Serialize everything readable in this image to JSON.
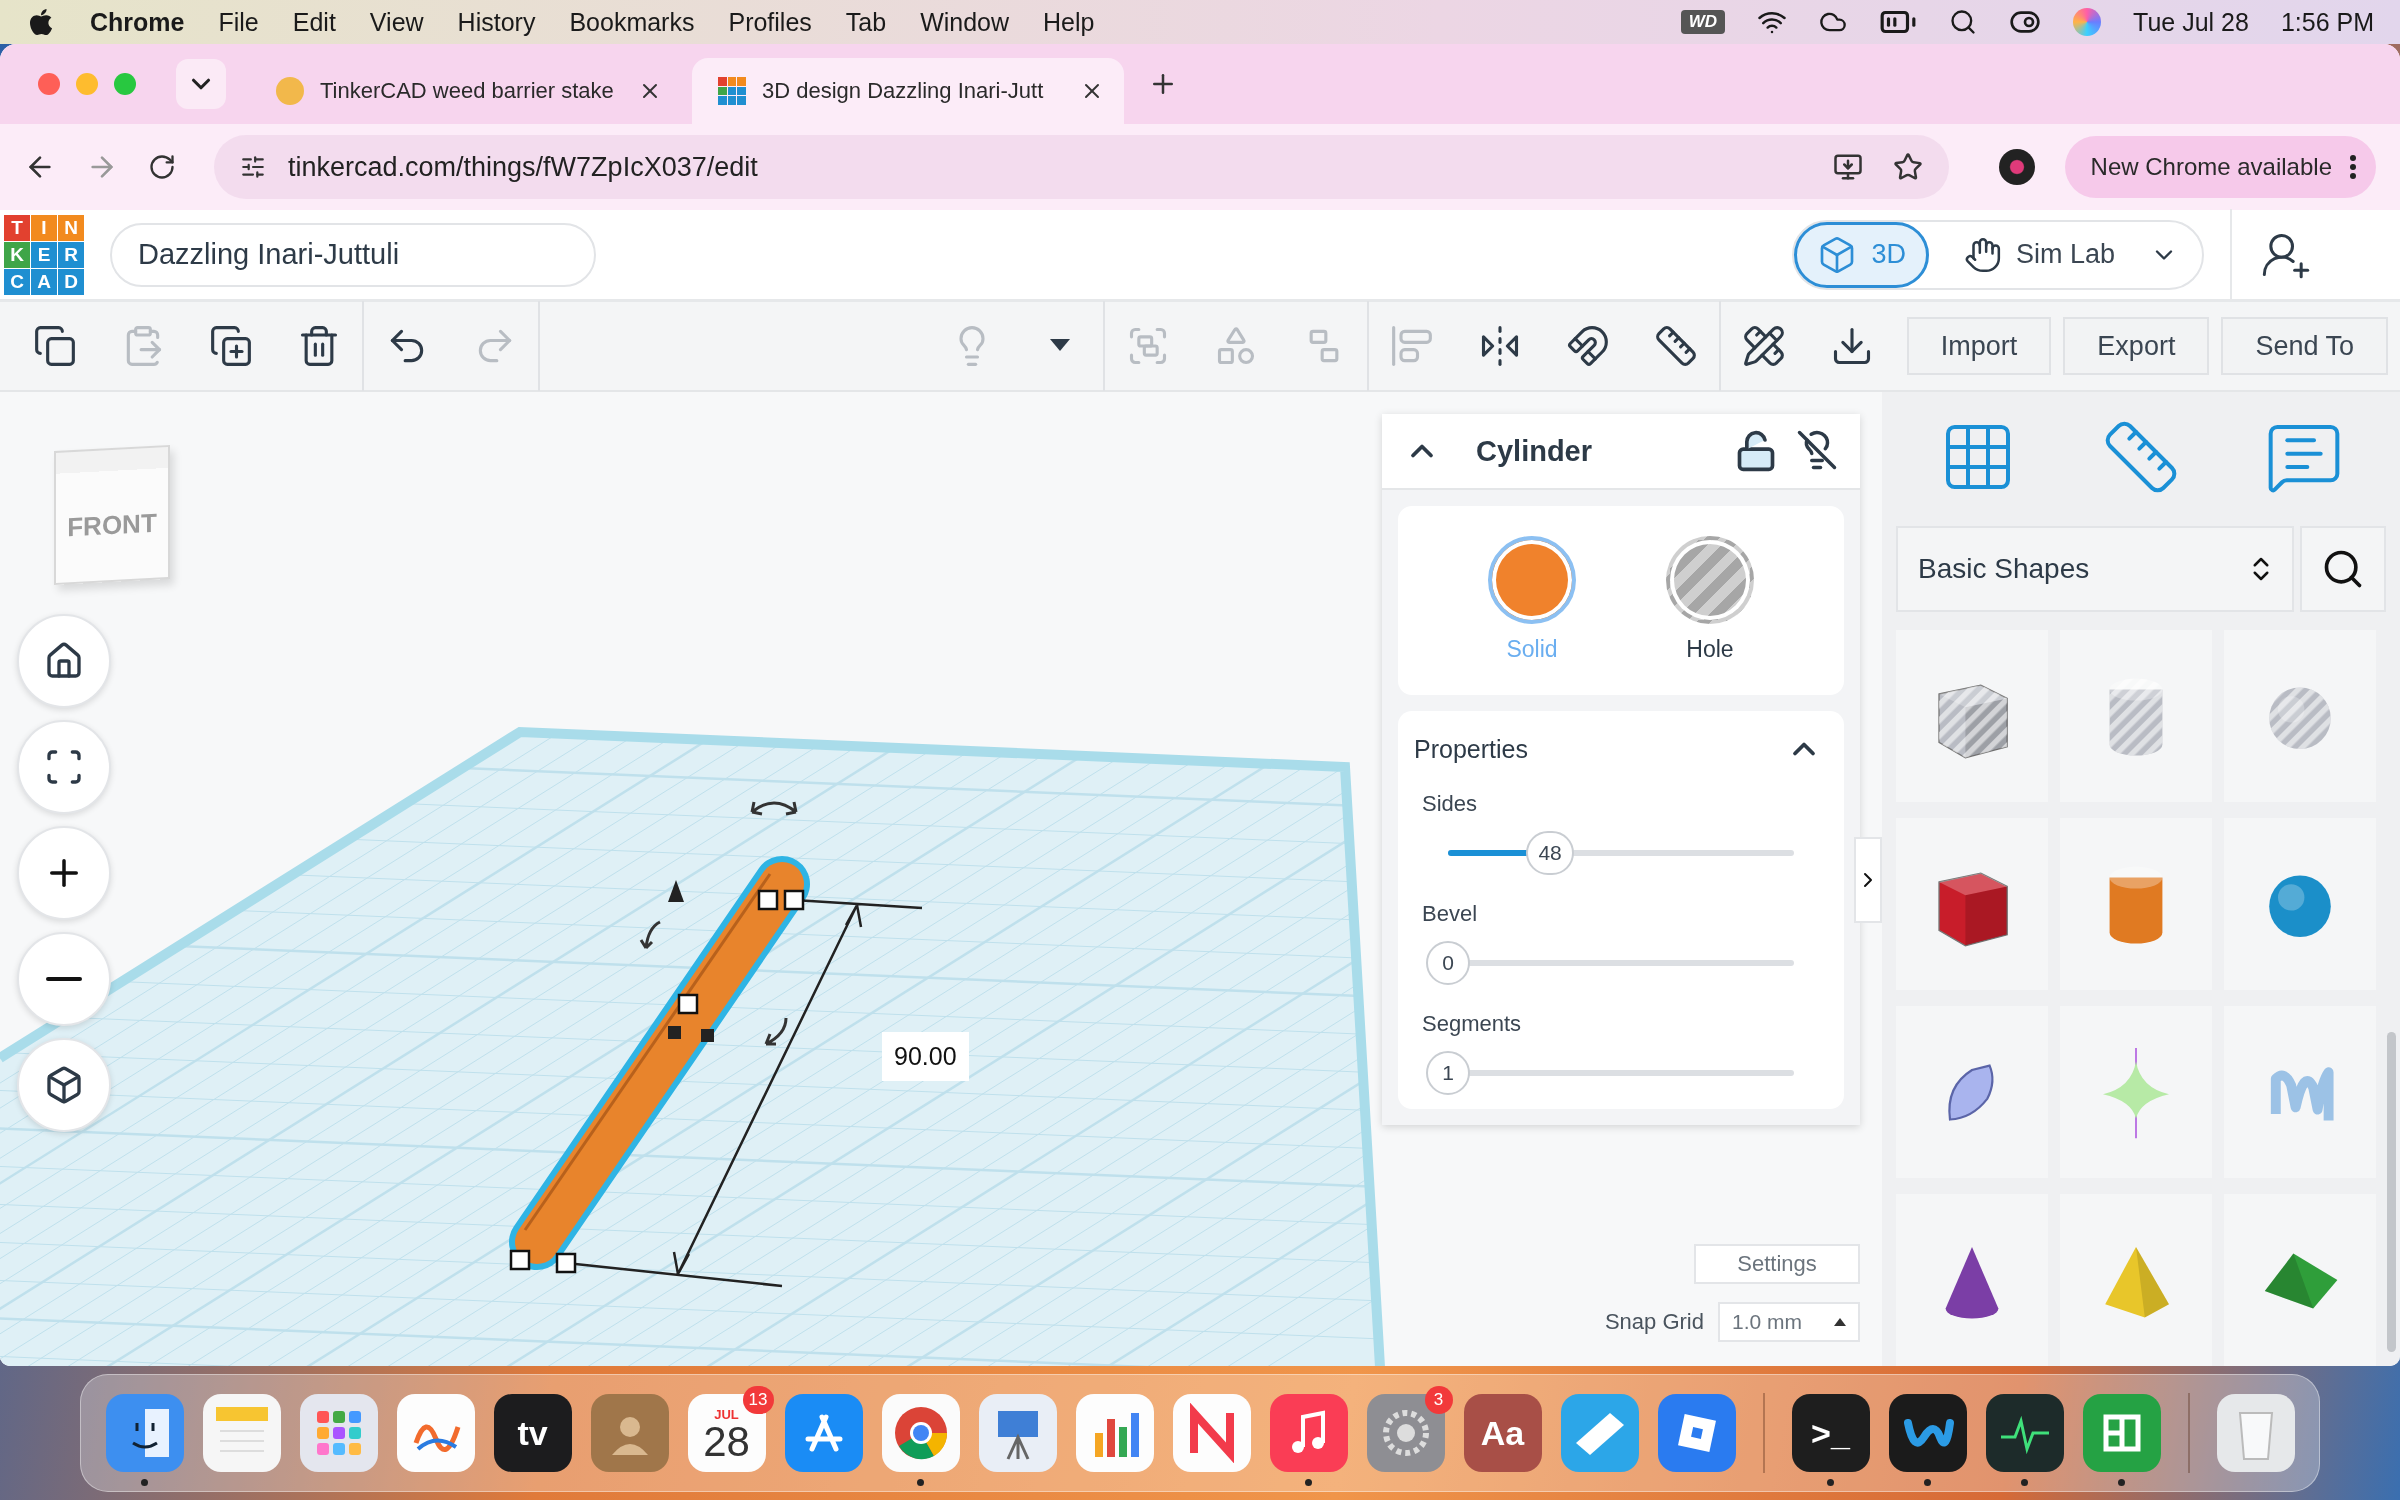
{
  "menu_bar": {
    "app_name": "Chrome",
    "items": [
      "File",
      "Edit",
      "View",
      "History",
      "Bookmarks",
      "Profiles",
      "Tab",
      "Window",
      "Help"
    ],
    "drive_badge": "WD",
    "date": "Tue Jul 28",
    "time": "1:56 PM"
  },
  "browser": {
    "tabs": [
      {
        "title": "TinkerCAD weed barrier stake",
        "selected": false,
        "kind": "figure"
      },
      {
        "title": "3D design Dazzling Inari-Jutt",
        "selected": true,
        "kind": "logo"
      }
    ],
    "url": "tinkercad.com/things/fW7ZpIcX037/edit",
    "update_label": "New Chrome available"
  },
  "app": {
    "logo_letters": [
      "T",
      "I",
      "N",
      "K",
      "E",
      "R",
      "C",
      "A",
      "D"
    ],
    "design_name": "Dazzling Inari-Juttuli",
    "modes": [
      {
        "label": "3D",
        "kind": "cube",
        "selected": true
      },
      {
        "label": "Sim Lab",
        "kind": "hand",
        "selected": false
      }
    ],
    "toolbar": {
      "left_groups": [
        [
          {
            "kind": "copy",
            "disabled": false
          },
          {
            "kind": "paste",
            "disabled": true
          },
          {
            "kind": "duplicate",
            "disabled": false
          },
          {
            "kind": "delete",
            "disabled": false
          }
        ],
        [
          {
            "kind": "undo",
            "disabled": false
          },
          {
            "kind": "redo",
            "disabled": true
          }
        ]
      ],
      "right_groups": [
        [
          {
            "kind": "light",
            "disabled": true
          },
          {
            "kind": "light-menu",
            "disabled": false
          }
        ],
        [
          {
            "kind": "group",
            "disabled": true
          },
          {
            "kind": "combine",
            "disabled": true
          },
          {
            "kind": "ungroup",
            "disabled": true
          }
        ],
        [
          {
            "kind": "align",
            "disabled": true
          },
          {
            "kind": "mirror",
            "disabled": false
          },
          {
            "kind": "magnet",
            "disabled": false
          },
          {
            "kind": "ruler",
            "disabled": false
          }
        ],
        [
          {
            "kind": "workplane",
            "disabled": false
          },
          {
            "kind": "drop",
            "disabled": false
          }
        ]
      ],
      "actions": [
        "Import",
        "Export",
        "Send To"
      ]
    }
  },
  "viewport": {
    "view_cube": "FRONT",
    "dimension": "90.00",
    "settings": "Settings",
    "snap_label": "Snap Grid",
    "snap_value": "1.0 mm"
  },
  "inspector": {
    "title": "Cylinder",
    "locked": false,
    "materials": [
      {
        "label": "Solid",
        "kind": "solid",
        "selected": true
      },
      {
        "label": "Hole",
        "kind": "hole",
        "selected": false
      }
    ],
    "properties_title": "Properties",
    "sliders": [
      {
        "label": "Sides",
        "value": "48",
        "level": 0.31
      },
      {
        "label": "Bevel",
        "value": "0",
        "level": 0
      },
      {
        "label": "Segments",
        "value": "1",
        "level": 0
      }
    ]
  },
  "library": {
    "category": "Basic Shapes",
    "shapes": [
      {
        "kind": "box",
        "color": "#b9bcc4",
        "hole": true
      },
      {
        "kind": "cylinder",
        "color": "#b9bcc4",
        "hole": true
      },
      {
        "kind": "sphere",
        "color": "#b9bcc4",
        "hole": true
      },
      {
        "kind": "box",
        "color": "#c81d2a",
        "hole": false
      },
      {
        "kind": "cylinder",
        "color": "#e07a22",
        "hole": false
      },
      {
        "kind": "sphere",
        "color": "#1b8fc9",
        "hole": false
      },
      {
        "kind": "pen",
        "color": "#a9b4ee"
      },
      {
        "kind": "spinner",
        "color": "#b7eaa6"
      },
      {
        "kind": "scribble",
        "color": "#9cc2e6"
      },
      {
        "kind": "cone",
        "color": "#7b3ea6"
      },
      {
        "kind": "pyramid",
        "color": "#e8c62a"
      },
      {
        "kind": "roof",
        "color": "#2f9e3a"
      }
    ]
  },
  "dock": [
    {
      "kind": "face",
      "color": "#3d8ff0",
      "running": true
    },
    {
      "kind": "notes",
      "color": "#f6f6f6",
      "running": false
    },
    {
      "kind": "grid",
      "color": "#e4e6ee",
      "running": false
    },
    {
      "kind": "scribble",
      "color": "#fdfdfd",
      "running": false
    },
    {
      "kind": "label",
      "color": "#1c1c1e",
      "label": "tv",
      "running": false
    },
    {
      "kind": "person",
      "color": "#a0764a",
      "running": false
    },
    {
      "kind": "calendar",
      "color": "#fdfdfd",
      "month": "JUL",
      "day": "28",
      "badge": "13",
      "running": false
    },
    {
      "kind": "appstore",
      "color": "#1a8cf5",
      "running": false
    },
    {
      "kind": "chrome",
      "color": "#fbfbfb",
      "running": true
    },
    {
      "kind": "easel",
      "color": "#e9eef6",
      "running": false
    },
    {
      "kind": "bars",
      "color": "#fdfdfd",
      "running": false
    },
    {
      "kind": "news",
      "color": "#fdfdfd",
      "running": false
    },
    {
      "kind": "music",
      "color": "#fa3d55",
      "running": true
    },
    {
      "kind": "gear",
      "color": "#8e8e93",
      "badge": "3",
      "running": false
    },
    {
      "kind": "label",
      "color": "#a84f47",
      "label": "Aa",
      "running": false
    },
    {
      "kind": "stripe",
      "color": "#2ca6e8",
      "running": false
    },
    {
      "kind": "square",
      "color": "#2a7bf0",
      "running": false
    },
    {
      "kind": "separator"
    },
    {
      "kind": "label",
      "color": "#1e1e1e",
      "label": ">_",
      "running": true
    },
    {
      "kind": "loop",
      "color": "#1b1b1b",
      "running": true
    },
    {
      "kind": "chart",
      "color": "#1d2b2a",
      "running": true
    },
    {
      "kind": "columns",
      "color": "#25a244",
      "running": true
    },
    {
      "kind": "separator"
    },
    {
      "kind": "trash",
      "color": "#e6e8ea",
      "running": false
    }
  ]
}
